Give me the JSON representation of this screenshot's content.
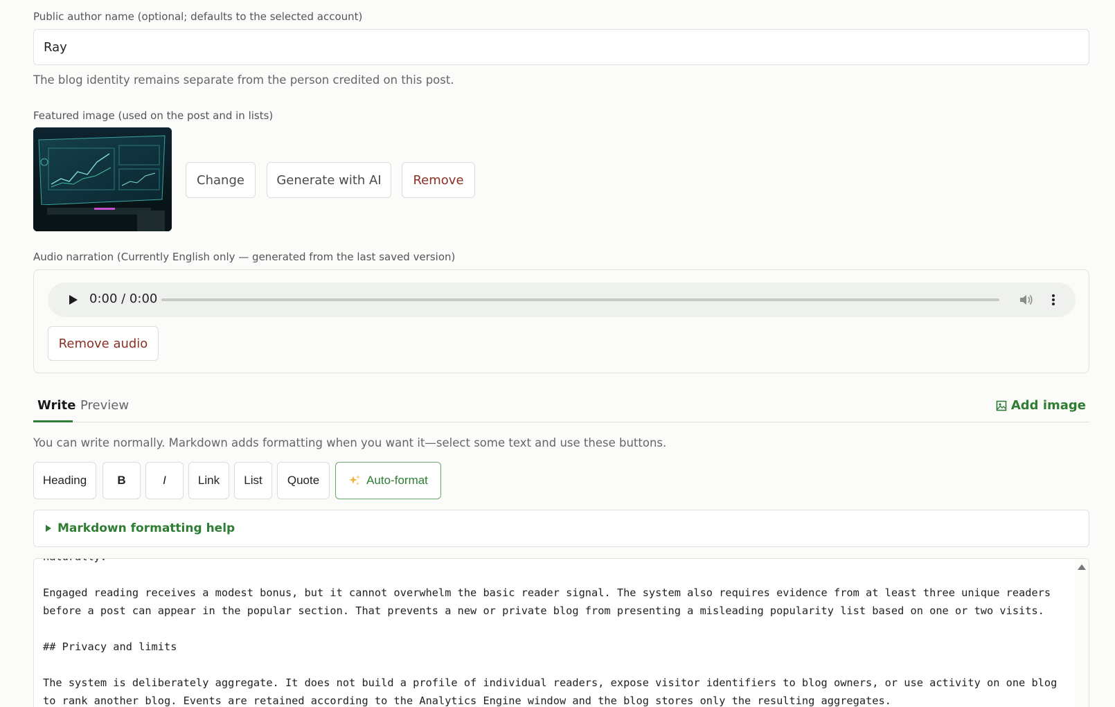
{
  "author": {
    "label": "Public author name (optional; defaults to the selected account)",
    "value": "Ray",
    "help": "The blog identity remains separate from the person credited on this post."
  },
  "featured_image": {
    "label": "Featured image (used on the post and in lists)",
    "change_label": "Change",
    "generate_label": "Generate with AI",
    "remove_label": "Remove"
  },
  "audio": {
    "label": "Audio narration (Currently English only — generated from the last saved version)",
    "time": "0:00 / 0:00",
    "remove_label": "Remove audio"
  },
  "tabs": {
    "write": "Write",
    "preview": "Preview",
    "add_image": "Add image"
  },
  "editor_help": "You can write normally. Markdown adds formatting when you want it—select some text and use these buttons.",
  "toolbar": {
    "heading": "Heading",
    "bold": "B",
    "italic": "I",
    "link": "Link",
    "list": "List",
    "quote": "Quote",
    "autoformat": "Auto-format"
  },
  "markdown_help": "Markdown formatting help",
  "editor_lines": [
    "naturally.",
    "",
    "Engaged reading receives a modest bonus, but it cannot overwhelm the basic reader signal. The system also requires evidence from at least three unique readers",
    "before a post can appear in the popular section. That prevents a new or private blog from presenting a misleading popularity list based on one or two visits.",
    "",
    "## Privacy and limits",
    "",
    "The system is deliberately aggregate. It does not build a profile of individual readers, expose visitor identifiers to blog owners, or use activity on one blog",
    "to rank another blog. Events are retained according to the Analytics Engine window and the blog stores only the resulting aggregates."
  ],
  "colors": {
    "accent": "#2e7d32",
    "danger": "#8a2f24",
    "background": "#fbfbf9"
  }
}
